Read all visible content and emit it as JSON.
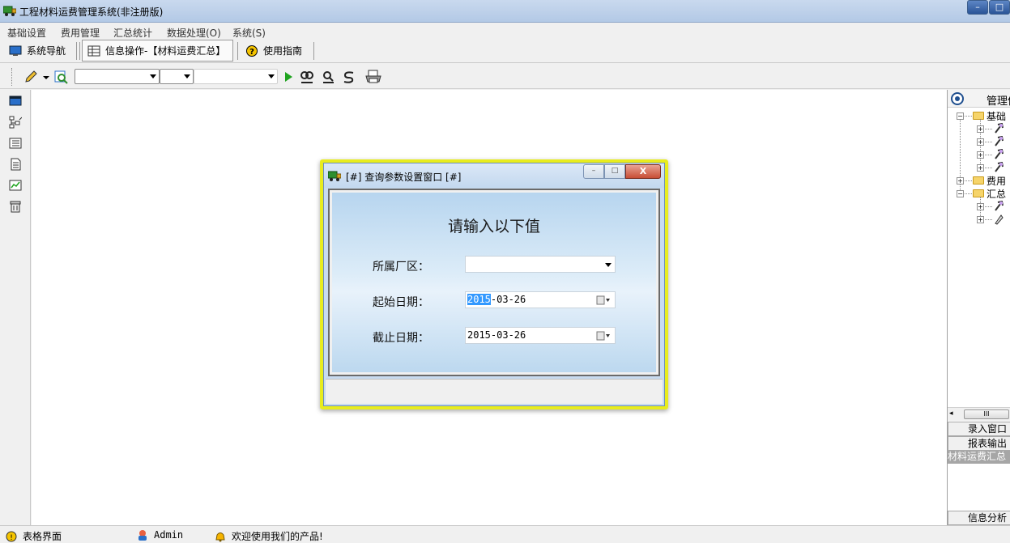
{
  "window": {
    "title": "工程材料运费管理系统(非注册版)",
    "min_label": "–",
    "max_label": "□"
  },
  "menu": [
    "基础设置",
    "费用管理",
    "汇总统计",
    "数据处理(O)",
    "系统(S)"
  ],
  "nav": {
    "tabs": [
      {
        "label": "系统导航"
      },
      {
        "label": "信息操作-【材料运费汇总】"
      },
      {
        "label": "使用指南"
      }
    ]
  },
  "right_panel": {
    "header": "管理信",
    "tree": [
      {
        "label": "基础"
      },
      {
        "label": "费用"
      },
      {
        "label": "汇总"
      }
    ],
    "scroll_thumb": "III",
    "scroll_left": "◂",
    "buttons": [
      "录入窗口",
      "报表输出"
    ],
    "selected_item": "材料运费汇总",
    "bottom_button": "信息分析"
  },
  "status": {
    "items": [
      "表格界面",
      "Admin",
      "欢迎使用我们的产品!"
    ]
  },
  "dialog": {
    "title": "[#] 查询参数设置窗口 [#]",
    "heading": "请输入以下值",
    "close_label": "X",
    "min_label": "–",
    "max_label": "□",
    "fields": [
      {
        "label": "所属厂区：",
        "value": ""
      },
      {
        "label": "起始日期：",
        "value_selected": "2015",
        "value_rest": "-03-26"
      },
      {
        "label": "截止日期：",
        "value": "2015-03-26"
      }
    ]
  },
  "colors": {
    "dialog_highlight": "#e8ec1e",
    "selection": "#3399ff",
    "titlebar": "#b3c9e6"
  }
}
